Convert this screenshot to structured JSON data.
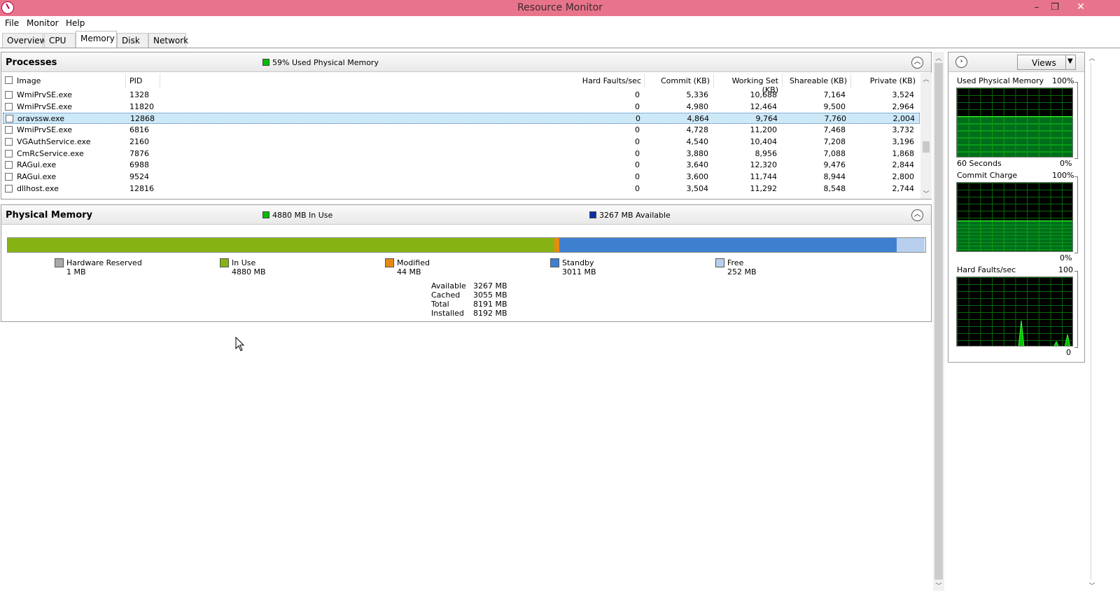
{
  "window": {
    "title": "Resource Monitor",
    "minimize": "–",
    "restore": "❐",
    "close": "✕"
  },
  "menu": [
    "File",
    "Monitor",
    "Help"
  ],
  "tabs": [
    {
      "label": "Overview",
      "active": false
    },
    {
      "label": "CPU",
      "active": false
    },
    {
      "label": "Memory",
      "active": true
    },
    {
      "label": "Disk",
      "active": false
    },
    {
      "label": "Network",
      "active": false
    }
  ],
  "processes": {
    "title": "Processes",
    "summary": "59% Used Physical Memory",
    "summary_color": "#00c000",
    "columns": [
      "Image",
      "PID",
      "Hard Faults/sec",
      "Commit (KB)",
      "Working Set (KB)",
      "Shareable (KB)",
      "Private (KB)"
    ],
    "rows": [
      {
        "image": "WmiPrvSE.exe",
        "pid": "1328",
        "faults": "0",
        "commit": "5,336",
        "ws": "10,688",
        "share": "7,164",
        "priv": "3,524",
        "selected": false
      },
      {
        "image": "WmiPrvSE.exe",
        "pid": "11820",
        "faults": "0",
        "commit": "4,980",
        "ws": "12,464",
        "share": "9,500",
        "priv": "2,964",
        "selected": false
      },
      {
        "image": "oravssw.exe",
        "pid": "12868",
        "faults": "0",
        "commit": "4,864",
        "ws": "9,764",
        "share": "7,760",
        "priv": "2,004",
        "selected": true
      },
      {
        "image": "WmiPrvSE.exe",
        "pid": "6816",
        "faults": "0",
        "commit": "4,728",
        "ws": "11,200",
        "share": "7,468",
        "priv": "3,732",
        "selected": false
      },
      {
        "image": "VGAuthService.exe",
        "pid": "2160",
        "faults": "0",
        "commit": "4,540",
        "ws": "10,404",
        "share": "7,208",
        "priv": "3,196",
        "selected": false
      },
      {
        "image": "CmRcService.exe",
        "pid": "7876",
        "faults": "0",
        "commit": "3,880",
        "ws": "8,956",
        "share": "7,088",
        "priv": "1,868",
        "selected": false
      },
      {
        "image": "RAGui.exe",
        "pid": "6988",
        "faults": "0",
        "commit": "3,640",
        "ws": "12,320",
        "share": "9,476",
        "priv": "2,844",
        "selected": false
      },
      {
        "image": "RAGui.exe",
        "pid": "9524",
        "faults": "0",
        "commit": "3,600",
        "ws": "11,744",
        "share": "8,944",
        "priv": "2,800",
        "selected": false
      },
      {
        "image": "dllhost.exe",
        "pid": "12816",
        "faults": "0",
        "commit": "3,504",
        "ws": "11,292",
        "share": "8,548",
        "priv": "2,744",
        "selected": false
      }
    ]
  },
  "physical_memory": {
    "title": "Physical Memory",
    "in_use_summary": "4880 MB In Use",
    "available_summary": "3267 MB Available",
    "colors": {
      "hardware": "#a9a9a9",
      "inuse": "#86b313",
      "modified": "#e58a12",
      "standby": "#3f7fd0",
      "free": "#b8d0ee"
    },
    "bar_fractions": {
      "hardware": 0.0001,
      "inuse": 0.5958,
      "modified": 0.0054,
      "standby": 0.3676,
      "free": 0.0308
    },
    "legend": [
      {
        "key": "hardware",
        "label": "Hardware Reserved",
        "value": "1 MB"
      },
      {
        "key": "inuse",
        "label": "In Use",
        "value": "4880 MB"
      },
      {
        "key": "modified",
        "label": "Modified",
        "value": "44 MB"
      },
      {
        "key": "standby",
        "label": "Standby",
        "value": "3011 MB"
      },
      {
        "key": "free",
        "label": "Free",
        "value": "252 MB"
      }
    ],
    "stats": [
      {
        "label": "Available",
        "value": "3267 MB"
      },
      {
        "label": "Cached",
        "value": "3055 MB"
      },
      {
        "label": "Total",
        "value": "8191 MB"
      },
      {
        "label": "Installed",
        "value": "8192 MB"
      }
    ]
  },
  "side": {
    "views_label": "Views",
    "graphs": [
      {
        "title": "Used Physical Memory",
        "max": "100%",
        "bottom_left": "60 Seconds",
        "bottom_right": "0%",
        "level": 0.59
      },
      {
        "title": "Commit Charge",
        "max": "100%",
        "bottom_left": "",
        "bottom_right": "0%",
        "level": 0.45
      },
      {
        "title": "Hard Faults/sec",
        "max": "100",
        "bottom_left": "",
        "bottom_right": "0",
        "level": 0
      }
    ]
  }
}
